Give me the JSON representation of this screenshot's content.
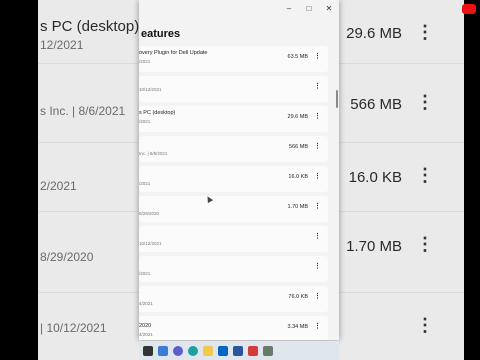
{
  "window": {
    "title": "eatures",
    "controls": [
      "–",
      "□",
      "✕"
    ]
  },
  "apps": [
    {
      "name": "overy Plugin for Dell Update",
      "sub": "/2021",
      "size": "63.5 MB"
    },
    {
      "name": "",
      "sub": "10/12/2021",
      "size": ""
    },
    {
      "name": "s PC (desktop)",
      "sub": "/2021",
      "size": "29.6 MB"
    },
    {
      "name": "",
      "sub": "Inc.  |  8/6/2021",
      "size": "566 MB"
    },
    {
      "name": "",
      "sub": "/2021",
      "size": "16.0 KB"
    },
    {
      "name": "",
      "sub": "8/29/2020",
      "size": "1.70 MB"
    },
    {
      "name": "",
      "sub": "10/12/2021",
      "size": ""
    },
    {
      "name": "",
      "sub": "/2021",
      "size": ""
    },
    {
      "name": "",
      "sub": "4/2021",
      "size": "76.0 KB"
    },
    {
      "name": "2020",
      "sub": "4/2021",
      "size": "3.34 MB"
    }
  ],
  "background": {
    "rows": [
      {
        "title": "s PC (desktop)",
        "sub": "12/2021",
        "size": "29.6 MB"
      },
      {
        "title": "",
        "sub": "s Inc.  |  8/6/2021",
        "size": "566 MB"
      },
      {
        "title": "",
        "sub": "2/2021",
        "size": "16.0 KB"
      },
      {
        "title": "",
        "sub": "8/29/2020",
        "size": "1.70 MB"
      },
      {
        "title": "",
        "sub": "  |  10/12/2021",
        "size": ""
      }
    ]
  },
  "more_glyph": "⋮",
  "colors": {
    "accent": "#0067c0",
    "taskbar": "#dfe6ee",
    "window": "#f3f3f3"
  },
  "taskbar_icons": [
    "task-view-icon",
    "widgets-icon",
    "chat-icon",
    "edge-icon",
    "explorer-icon",
    "mail-icon",
    "word-icon",
    "app-icon",
    "settings-icon"
  ]
}
